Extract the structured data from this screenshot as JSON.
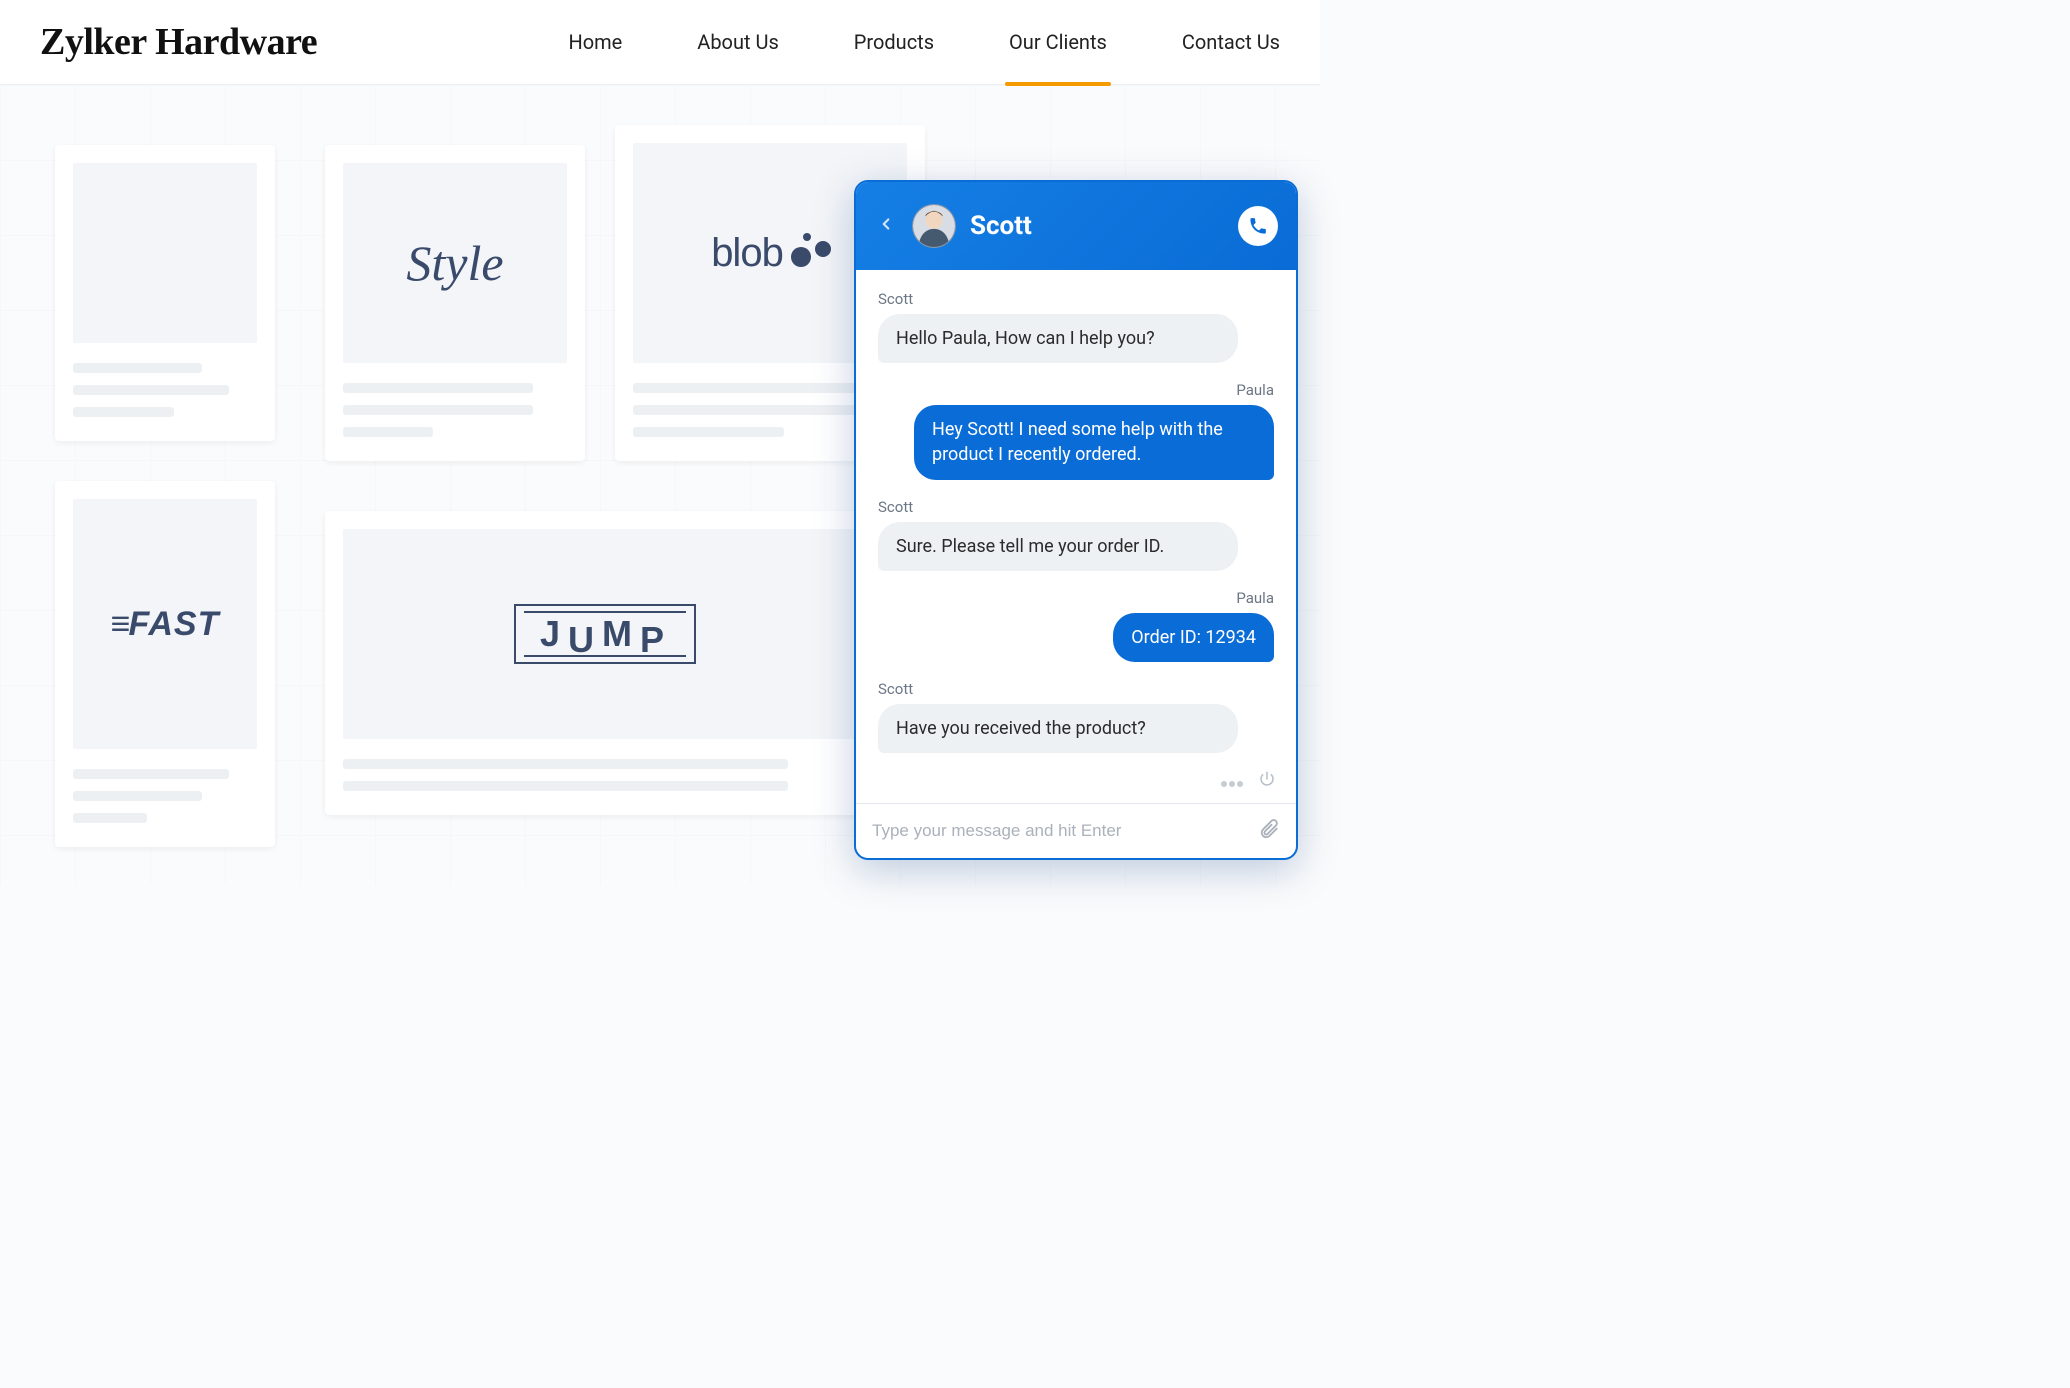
{
  "header": {
    "brand": "Zylker Hardware",
    "nav": [
      {
        "label": "Home",
        "active": false
      },
      {
        "label": "About Us",
        "active": false
      },
      {
        "label": "Products",
        "active": false
      },
      {
        "label": "Our Clients",
        "active": true
      },
      {
        "label": "Contact Us",
        "active": false
      }
    ]
  },
  "clients": {
    "card_a": {
      "logo": ""
    },
    "card_b": {
      "logo": "Style"
    },
    "card_c": {
      "logo": "blob"
    },
    "card_d": {
      "logo": "FAST"
    },
    "card_e": {
      "logo": "JUMP"
    }
  },
  "chat": {
    "agent_name": "Scott",
    "messages": [
      {
        "author": "Scott",
        "side": "left",
        "text": "Hello Paula, How can I help you?"
      },
      {
        "author": "Paula",
        "side": "right",
        "text": "Hey Scott! I need some help with the product I recently ordered."
      },
      {
        "author": "Scott",
        "side": "left",
        "text": "Sure. Please tell me your order ID."
      },
      {
        "author": "Paula",
        "side": "right",
        "text": "Order ID: 12934"
      },
      {
        "author": "Scott",
        "side": "left",
        "text": "Have you received the product?"
      }
    ],
    "input_placeholder": "Type your message and hit Enter"
  }
}
